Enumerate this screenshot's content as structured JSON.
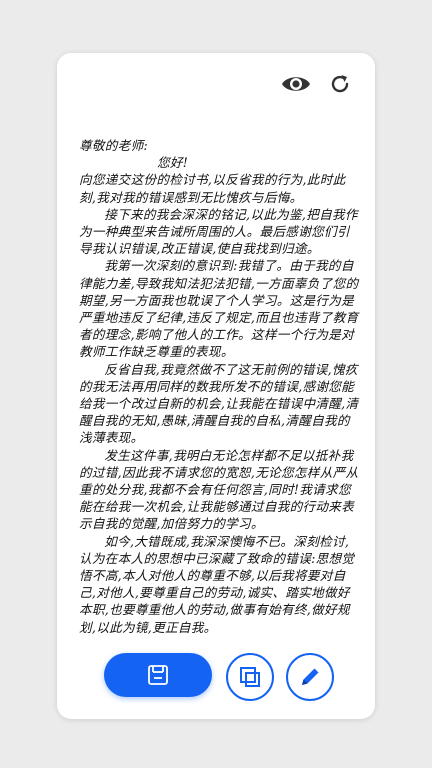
{
  "toolbar": {
    "preview_icon": "eye-icon",
    "refresh_icon": "refresh-icon"
  },
  "letter": {
    "salutation": "尊敬的老师:",
    "greeting": "您好!",
    "paragraphs": [
      "向您递交这份的检讨书,以反省我的行为,此时此刻,我对我的错误感到无比愧疚与后悔。",
      "接下来的我会深深的铭记,以此为鉴,把自我作为一种典型来告诫所周围的人。最后感谢您们引导我认识错误,改正错误,使自我找到归途。",
      "我第一次深刻的意识到:我错了。由于我的自律能力差,导致我知法犯法犯错,一方面辜负了您的期望,另一方面我也耽误了个人学习。这是行为是严重地违反了纪律,违反了规定,而且也违背了教育者的理念,影响了他人的工作。这样一个行为是对教师工作缺乏尊重的表现。",
      "反省自我,我竟然做不了这无前例的错误,愧疚的我无法再用同样的数我所发不的错误,感谢您能给我一个改过自新的机会,让我能在错误中清醒,清醒自我的无知,愚昧,清醒自我的自私,清醒自我的浅薄表现。",
      "发生这件事,我明白无论怎样都不足以抵补我的过错,因此我不请求您的宽恕,无论您怎样从严从重的处分我,我都不会有任何怨言,同时!我请求您能在给我一次机会,让我能够通过自我的行动来表示自我的觉醒,加倍努力的学习。",
      "如今,大错既成,我深深懊悔不已。深刻检讨,认为在本人的思想中已深藏了致命的错误:思想觉悟不高,本人对他人的尊重不够,以后我将要对自己,对他人,要尊重自己的劳动,诚实、踏实地做好本职,也要尊重他人的劳动,做事有始有终,做好规划,以此为镜,更正自我。"
    ]
  },
  "actions": {
    "save_icon": "save-icon",
    "format_icon": "format-icon",
    "edit_icon": "pencil-icon"
  },
  "colors": {
    "accent": "#1463f3",
    "background": "#ebebeb",
    "card": "#ffffff",
    "text": "#111111"
  }
}
